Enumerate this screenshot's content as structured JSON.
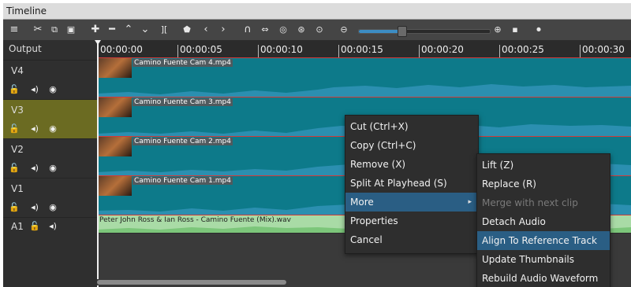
{
  "window": {
    "title": "Timeline"
  },
  "toolbar": {
    "icons": [
      "menu-icon",
      "cut-icon",
      "copy-icon",
      "paste-icon",
      "append-icon",
      "remove-icon",
      "lift-icon",
      "overwrite-icon",
      "split-icon",
      "marker-icon",
      "prev-marker-icon",
      "next-marker-icon",
      "snap-icon",
      "scrub-icon",
      "ripple-icon",
      "ripple-all-icon",
      "ripple-markers-icon",
      "zoom-out-icon",
      "zoom-in-icon",
      "zoom-fit-icon",
      "record-audio-icon"
    ],
    "zoom_level": 0.35
  },
  "tracks": {
    "output_label": "Output",
    "video": [
      {
        "name": "V4",
        "clip": "Camino Fuente Cam 4.mp4",
        "selected": false
      },
      {
        "name": "V3",
        "clip": "Camino Fuente Cam 3.mp4",
        "selected": true
      },
      {
        "name": "V2",
        "clip": "Camino Fuente Cam 2.mp4",
        "selected": false
      },
      {
        "name": "V1",
        "clip": "Camino Fuente Cam 1.mp4",
        "selected": false
      }
    ],
    "audio": {
      "name": "A1",
      "clip": "Peter John Ross & Ian Ross - Camino Fuente (Mix).wav"
    }
  },
  "ruler": {
    "ticks": [
      "00:00:00",
      "00:00:05",
      "00:00:10",
      "00:00:15",
      "00:00:20",
      "00:00:25",
      "00:00:30"
    ]
  },
  "context_menu": {
    "items": [
      "Cut (Ctrl+X)",
      "Copy (Ctrl+C)",
      "Remove (X)",
      "Split At Playhead (S)",
      "More",
      "Properties",
      "Cancel"
    ],
    "highlighted": "More"
  },
  "submenu": {
    "items": [
      "Lift (Z)",
      "Replace (R)",
      "Merge with next clip",
      "Detach Audio",
      "Align To Reference Track",
      "Update Thumbnails",
      "Rebuild Audio Waveform"
    ],
    "disabled": [
      "Merge with next clip"
    ],
    "highlighted": "Align To Reference Track"
  },
  "colors": {
    "video_clip": "#0d7a8a",
    "audio_clip": "#a9dba6",
    "selected_track": "#6b6b22",
    "menu_highlight": "#2a5e84",
    "clip_border": "#d33a3a"
  }
}
